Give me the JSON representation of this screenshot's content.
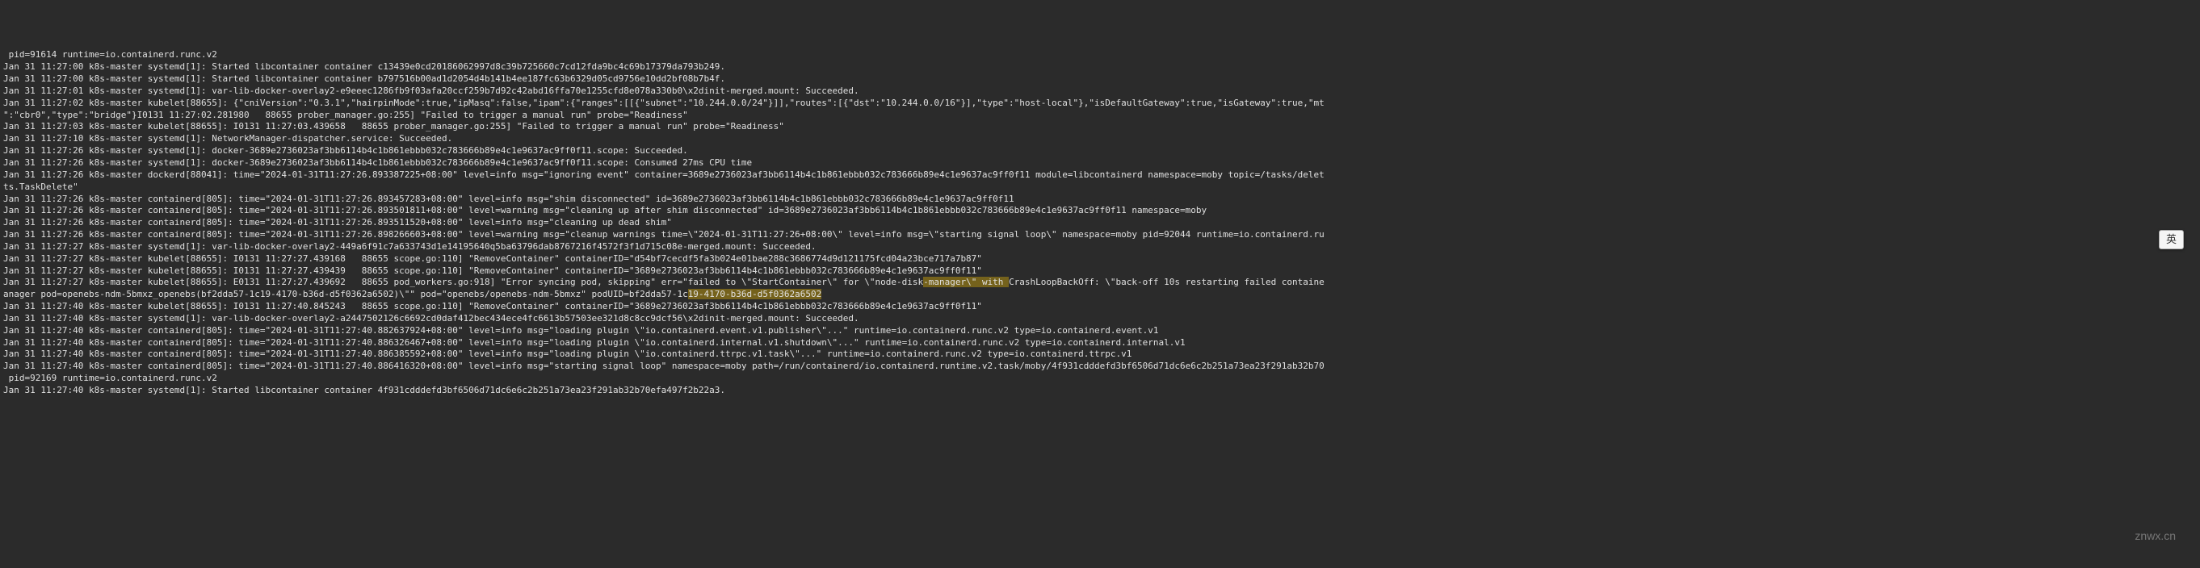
{
  "log_lines": [
    {
      "text": " pid=91614 runtime=io.containerd.runc.v2"
    },
    {
      "text": "Jan 31 11:27:00 k8s-master systemd[1]: Started libcontainer container c13439e0cd20186062997d8c39b725660c7cd12fda9bc4c69b17379da793b249."
    },
    {
      "text": "Jan 31 11:27:00 k8s-master systemd[1]: Started libcontainer container b797516b00ad1d2054d4b141b4ee187fc63b6329d05cd9756e10dd2bf08b7b4f."
    },
    {
      "text": "Jan 31 11:27:01 k8s-master systemd[1]: var-lib-docker-overlay2-e9eeec1286fb9f03afa20ccf259b7d92c42abd16ffa70e1255cfd8e078a330b0\\x2dinit-merged.mount: Succeeded."
    },
    {
      "text": "Jan 31 11:27:02 k8s-master kubelet[88655]: {\"cniVersion\":\"0.3.1\",\"hairpinMode\":true,\"ipMasq\":false,\"ipam\":{\"ranges\":[[{\"subnet\":\"10.244.0.0/24\"}]],\"routes\":[{\"dst\":\"10.244.0.0/16\"}],\"type\":\"host-local\"},\"isDefaultGateway\":true,\"isGateway\":true,\"mt"
    },
    {
      "text": "\":\"cbr0\",\"type\":\"bridge\"}I0131 11:27:02.281980   88655 prober_manager.go:255] \"Failed to trigger a manual run\" probe=\"Readiness\""
    },
    {
      "text": "Jan 31 11:27:03 k8s-master kubelet[88655]: I0131 11:27:03.439658   88655 prober_manager.go:255] \"Failed to trigger a manual run\" probe=\"Readiness\""
    },
    {
      "text": "Jan 31 11:27:10 k8s-master systemd[1]: NetworkManager-dispatcher.service: Succeeded."
    },
    {
      "text": "Jan 31 11:27:26 k8s-master systemd[1]: docker-3689e2736023af3bb6114b4c1b861ebbb032c783666b89e4c1e9637ac9ff0f11.scope: Succeeded."
    },
    {
      "text": "Jan 31 11:27:26 k8s-master systemd[1]: docker-3689e2736023af3bb6114b4c1b861ebbb032c783666b89e4c1e9637ac9ff0f11.scope: Consumed 27ms CPU time"
    },
    {
      "text": "Jan 31 11:27:26 k8s-master dockerd[88041]: time=\"2024-01-31T11:27:26.893387225+08:00\" level=info msg=\"ignoring event\" container=3689e2736023af3bb6114b4c1b861ebbb032c783666b89e4c1e9637ac9ff0f11 module=libcontainerd namespace=moby topic=/tasks/delet"
    },
    {
      "text": "ts.TaskDelete\""
    },
    {
      "text": "Jan 31 11:27:26 k8s-master containerd[805]: time=\"2024-01-31T11:27:26.893457283+08:00\" level=info msg=\"shim disconnected\" id=3689e2736023af3bb6114b4c1b861ebbb032c783666b89e4c1e9637ac9ff0f11"
    },
    {
      "text": "Jan 31 11:27:26 k8s-master containerd[805]: time=\"2024-01-31T11:27:26.893501811+08:00\" level=warning msg=\"cleaning up after shim disconnected\" id=3689e2736023af3bb6114b4c1b861ebbb032c783666b89e4c1e9637ac9ff0f11 namespace=moby"
    },
    {
      "text": "Jan 31 11:27:26 k8s-master containerd[805]: time=\"2024-01-31T11:27:26.893511520+08:00\" level=info msg=\"cleaning up dead shim\""
    },
    {
      "text": "Jan 31 11:27:26 k8s-master containerd[805]: time=\"2024-01-31T11:27:26.898266603+08:00\" level=warning msg=\"cleanup warnings time=\\\"2024-01-31T11:27:26+08:00\\\" level=info msg=\\\"starting signal loop\\\" namespace=moby pid=92044 runtime=io.containerd.ru"
    },
    {
      "text": "Jan 31 11:27:27 k8s-master systemd[1]: var-lib-docker-overlay2-449a6f91c7a633743d1e14195640q5ba63796dab8767216f4572f3f1d715c08e-merged.mount: Succeeded."
    },
    {
      "text": "Jan 31 11:27:27 k8s-master kubelet[88655]: I0131 11:27:27.439168   88655 scope.go:110] \"RemoveContainer\" containerID=\"d54bf7cecdf5fa3b024e01bae288c3686774d9d121175fcd04a23bce717a7b87\""
    },
    {
      "text": "Jan 31 11:27:27 k8s-master kubelet[88655]: I0131 11:27:27.439439   88655 scope.go:110] \"RemoveContainer\" containerID=\"3689e2736023af3bb6114b4c1b861ebbb032c783666b89e4c1e9637ac9ff0f11\""
    },
    {
      "text": "Jan 31 11:27:27 k8s-master kubelet[88655]: E0131 11:27:27.439692   88655 pod_workers.go:918] \"Error syncing pod, skipping\" err=\"failed to \\\"StartContainer\\\" for \\\"node-disk-manager\\\" with CrashLoopBackOff: \\\"back-off 10s restarting failed containe",
      "highlight": [
        172,
        188
      ]
    },
    {
      "text": "anager pod=openebs-ndm-5bmxz_openebs(bf2dda57-1c19-4170-b36d-d5f0362a6502)\\\"\" pod=\"openebs/openebs-ndm-5bmxz\" podUID=bf2dda57-1c19-4170-b36d-d5f0362a6502",
      "highlight": [
        128,
        164
      ]
    },
    {
      "text": "Jan 31 11:27:40 k8s-master kubelet[88655]: I0131 11:27:40.845243   88655 scope.go:110] \"RemoveContainer\" containerID=\"3689e2736023af3bb6114b4c1b861ebbb032c783666b89e4c1e9637ac9ff0f11\""
    },
    {
      "text": "Jan 31 11:27:40 k8s-master systemd[1]: var-lib-docker-overlay2-a2447502126c6692cd0daf412bec434ece4fc6613b57503ee321d8c8cc9dcf56\\x2dinit-merged.mount: Succeeded."
    },
    {
      "text": "Jan 31 11:27:40 k8s-master containerd[805]: time=\"2024-01-31T11:27:40.882637924+08:00\" level=info msg=\"loading plugin \\\"io.containerd.event.v1.publisher\\\"...\" runtime=io.containerd.runc.v2 type=io.containerd.event.v1"
    },
    {
      "text": "Jan 31 11:27:40 k8s-master containerd[805]: time=\"2024-01-31T11:27:40.886326467+08:00\" level=info msg=\"loading plugin \\\"io.containerd.internal.v1.shutdown\\\"...\" runtime=io.containerd.runc.v2 type=io.containerd.internal.v1"
    },
    {
      "text": "Jan 31 11:27:40 k8s-master containerd[805]: time=\"2024-01-31T11:27:40.886385592+08:00\" level=info msg=\"loading plugin \\\"io.containerd.ttrpc.v1.task\\\"...\" runtime=io.containerd.runc.v2 type=io.containerd.ttrpc.v1"
    },
    {
      "text": "Jan 31 11:27:40 k8s-master containerd[805]: time=\"2024-01-31T11:27:40.886416320+08:00\" level=info msg=\"starting signal loop\" namespace=moby path=/run/containerd/io.containerd.runtime.v2.task/moby/4f931cdddefd3bf6506d71dc6e6c2b251a73ea23f291ab32b70"
    },
    {
      "text": " pid=92169 runtime=io.containerd.runc.v2"
    },
    {
      "text": "Jan 31 11:27:40 k8s-master systemd[1]: Started libcontainer container 4f931cdddefd3bf6506d71dc6e6c2b251a73ea23f291ab32b70efa497f2b22a3."
    }
  ],
  "watermark": "znwx.cn",
  "ime": "英"
}
